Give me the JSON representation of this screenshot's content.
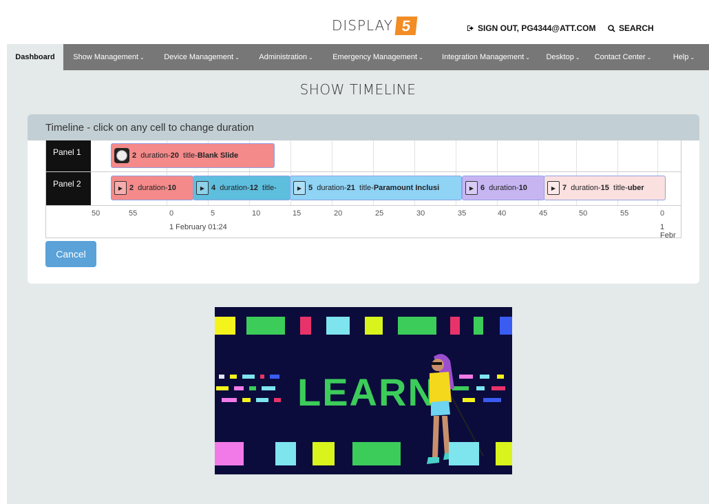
{
  "header": {
    "logo_text": "DISPLAY",
    "logo_mark": "5",
    "signout_label": "SIGN OUT, PG4344@ATT.COM",
    "search_label": "SEARCH",
    "brand_color": "#f28c24"
  },
  "nav": {
    "items": [
      {
        "label": "Dashboard",
        "active": true
      },
      {
        "label": "Show Management"
      },
      {
        "label": "Device Management"
      },
      {
        "label": "Administration"
      },
      {
        "label": "Emergency Management"
      },
      {
        "label": "Integration Management"
      },
      {
        "label": "Desktop"
      },
      {
        "label": "Contact Center"
      },
      {
        "label": "Help"
      }
    ]
  },
  "page": {
    "title": "SHOW TIMELINE"
  },
  "timeline": {
    "heading": "Timeline - click on any cell to change duration",
    "rows": [
      {
        "label": "Panel 1",
        "items": [
          {
            "id": "2",
            "duration_label": "duration-",
            "duration": "20",
            "title_label": "title-",
            "title": "Blank Slide",
            "icon": "clock-icon",
            "color": "#f48a8a"
          }
        ]
      },
      {
        "label": "Panel 2",
        "items": [
          {
            "id": "2",
            "duration_label": "duration-",
            "duration": "10",
            "title_label": "",
            "title": "",
            "icon": "file-play-icon",
            "color": "#f48a8a"
          },
          {
            "id": "4",
            "duration_label": "duration-",
            "duration": "12",
            "title_label": "title-",
            "title": "",
            "icon": "file-play-icon",
            "color": "#5ebede"
          },
          {
            "id": "5",
            "duration_label": "duration-",
            "duration": "21",
            "title_label": "title-",
            "title": "Paramount Inclusi",
            "icon": "file-play-icon",
            "color": "#8fd3f5"
          },
          {
            "id": "6",
            "duration_label": "duration-",
            "duration": "10",
            "title_label": "",
            "title": "",
            "icon": "file-play-icon",
            "color": "#c7b5f2"
          },
          {
            "id": "7",
            "duration_label": "duration-",
            "duration": "15",
            "title_label": "title-",
            "title": "uber",
            "icon": "file-play-icon",
            "color": "#fbe0e0"
          }
        ]
      }
    ],
    "ticks": [
      "50",
      "55",
      "0",
      "5",
      "10",
      "15",
      "20",
      "25",
      "30",
      "35",
      "40",
      "45",
      "50",
      "55",
      "0"
    ],
    "dates": [
      "1 February 01:24",
      "1 Febr"
    ]
  },
  "actions": {
    "cancel_label": "Cancel"
  },
  "preview": {
    "text": "LEARN"
  }
}
